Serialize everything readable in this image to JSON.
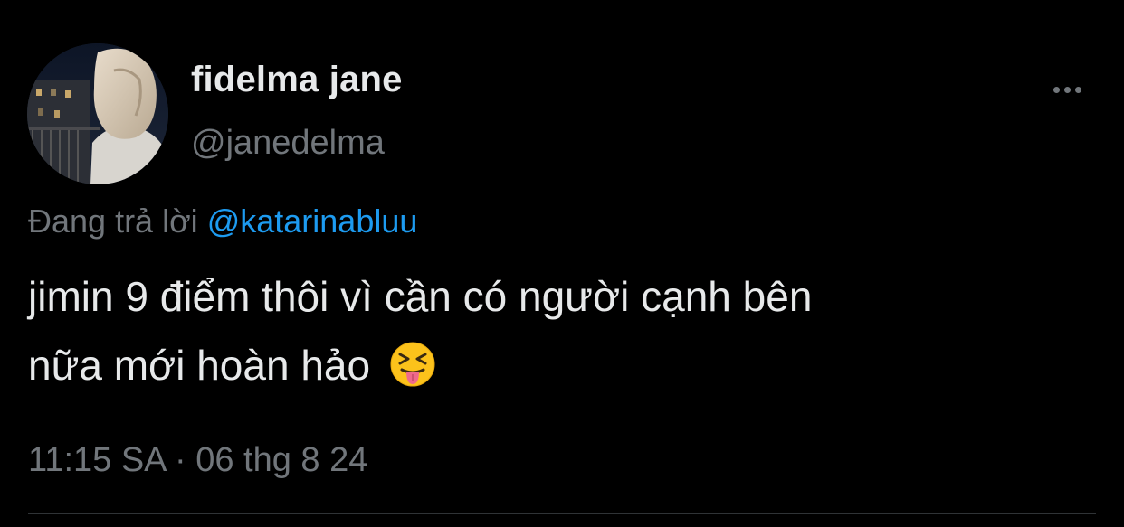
{
  "author": {
    "display_name": "fidelma jane",
    "handle": "@janedelma",
    "avatar_icon": "profile-photo"
  },
  "menu": {
    "more_icon": "ellipsis-icon"
  },
  "reply": {
    "prefix": "Đang trả lời",
    "mention": "@katarinabluu"
  },
  "tweet": {
    "line1": "jimin 9 điểm thôi vì cần có người cạnh bên",
    "line2": "nữa mới hoàn hảo",
    "emoji": "squinting-face-with-tongue-icon",
    "timestamp": "11:15 SA · 06 thg 8 24"
  },
  "colors": {
    "background": "#000000",
    "primary_text": "#e7e9ea",
    "secondary_text": "#71767b",
    "link": "#1d9bf0",
    "divider": "#2f3336"
  }
}
